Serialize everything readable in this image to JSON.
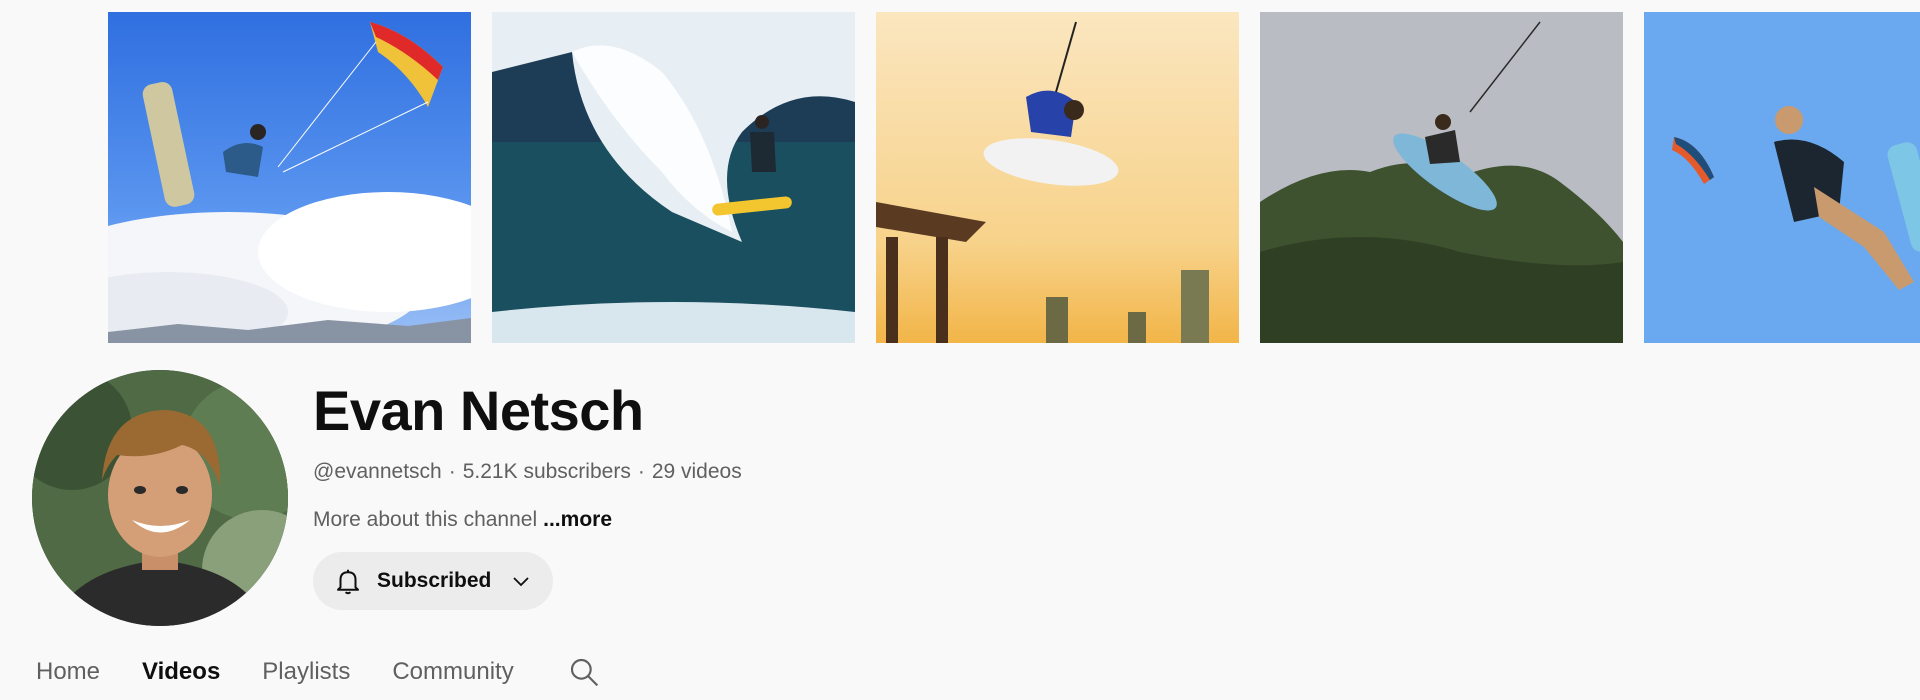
{
  "banner": {
    "tiles": [
      {
        "name": "banner-photo-kiteboard-jump"
      },
      {
        "name": "banner-photo-wave-ride"
      },
      {
        "name": "banner-photo-sunset-jump"
      },
      {
        "name": "banner-photo-mountain-jump"
      },
      {
        "name": "banner-photo-kite-trick"
      }
    ]
  },
  "channel": {
    "name": "Evan Netsch",
    "handle": "@evannetsch",
    "subscribers": "5.21K subscribers",
    "videos": "29 videos",
    "separator": "·",
    "about": "More about this channel",
    "more": "...more"
  },
  "subscribe": {
    "label": "Subscribed",
    "icon": "bell-icon",
    "dropdown_icon": "chevron-down-icon"
  },
  "tabs": [
    {
      "label": "Home",
      "active": false
    },
    {
      "label": "Videos",
      "active": true
    },
    {
      "label": "Playlists",
      "active": false
    },
    {
      "label": "Community",
      "active": false
    }
  ],
  "colors": {
    "background": "#f9f9f9",
    "text_primary": "#0f0f0f",
    "text_secondary": "#606060",
    "button_bg": "#ececec"
  }
}
